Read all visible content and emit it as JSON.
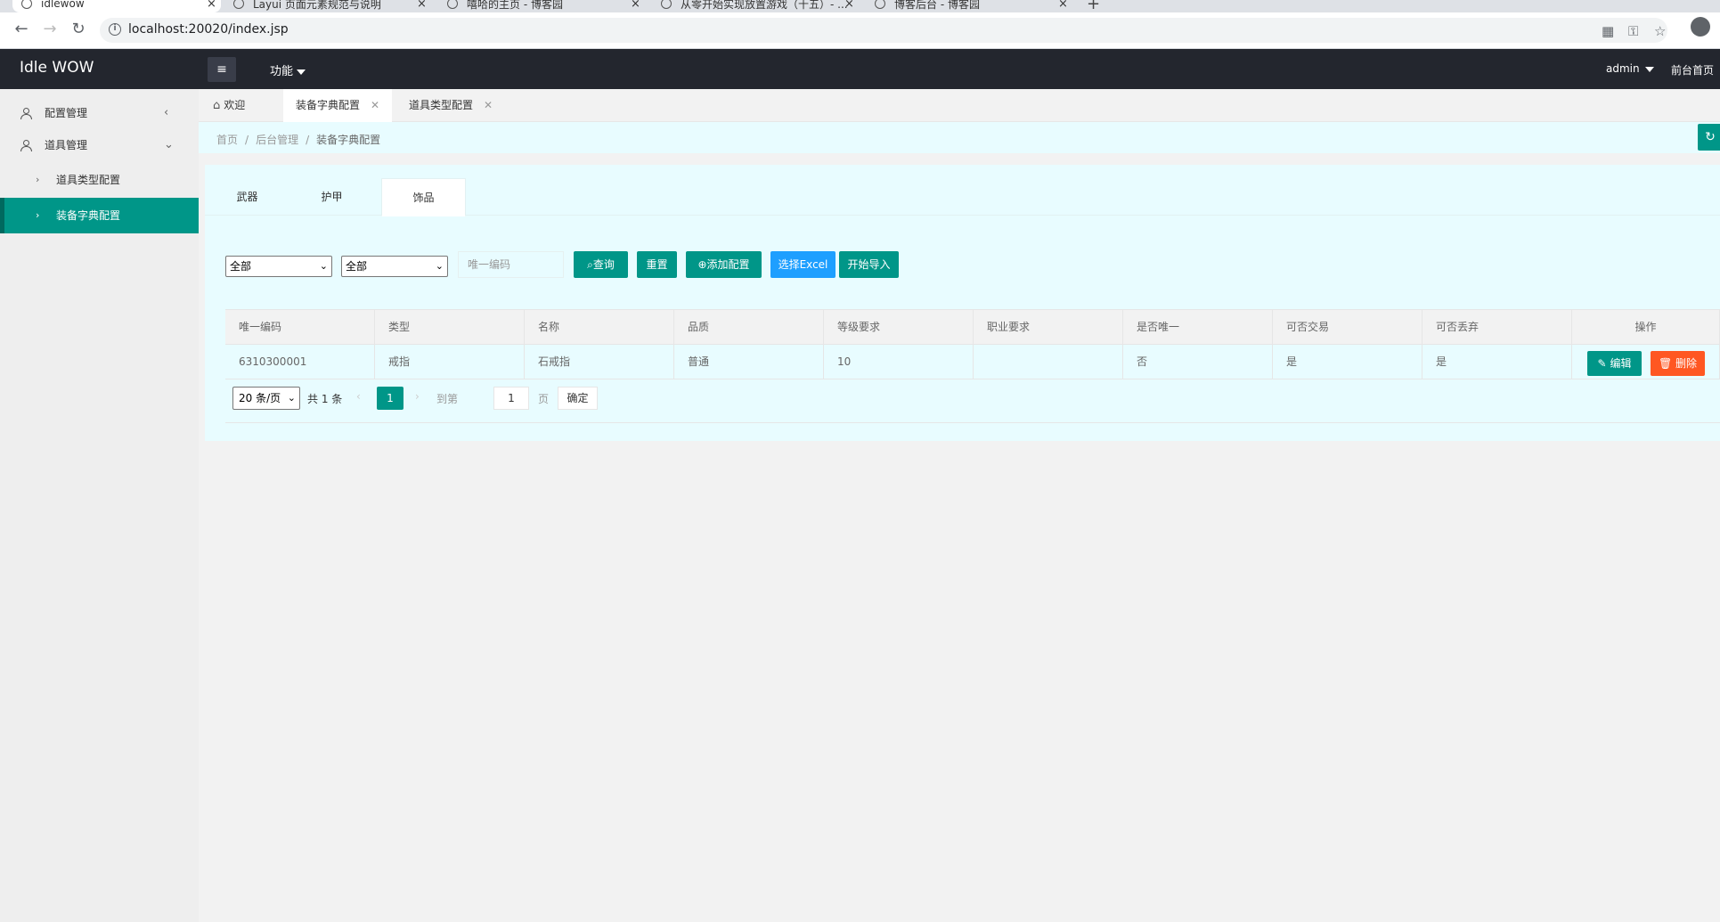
{
  "browser": {
    "tabs": [
      {
        "title": "idlewow",
        "close": "×"
      },
      {
        "title": "Layui 页面元素规范与说明",
        "close": "×"
      },
      {
        "title": "嘻哈的主页 - 博客园",
        "close": "×"
      },
      {
        "title": "从零开始实现放置游戏（十五）- ...",
        "close": "×"
      },
      {
        "title": "博客后台 - 博客园",
        "close": "×"
      }
    ],
    "new_tab": "+",
    "url": "localhost:20020/index.jsp"
  },
  "header": {
    "logo": "Idle WOW",
    "menu_icon": "≡",
    "func_label": "功能",
    "admin_label": "admin",
    "front_label": "前台首页"
  },
  "sidebar": {
    "items": [
      {
        "label": "配置管理",
        "chevron": "‹"
      },
      {
        "label": "道具管理",
        "chevron": "⌄"
      }
    ],
    "subitems": [
      {
        "label": "道具类型配置",
        "chevron": "›"
      },
      {
        "label": "装备字典配置",
        "chevron": "›"
      }
    ]
  },
  "page_tabs": [
    {
      "label": "欢迎",
      "icon": "⌂"
    },
    {
      "label": "装备字典配置",
      "close": "✕"
    },
    {
      "label": "道具类型配置",
      "close": "✕"
    }
  ],
  "breadcrumb": {
    "items": [
      "首页",
      "后台管理",
      "装备字典配置"
    ],
    "sep": "/",
    "refresh_icon": "↻"
  },
  "card_tabs": [
    "武器",
    "护甲",
    "饰品"
  ],
  "filters": {
    "select1": "全部",
    "select2": "全部",
    "dropdown_glyph": "⌄",
    "code_placeholder": "唯一编码",
    "search_btn": "查询",
    "search_icon": "⌕",
    "reset_btn": "重置",
    "add_btn": "添加配置",
    "add_icon": "⊕",
    "excel_btn": "选择Excel",
    "import_btn": "开始导入"
  },
  "table": {
    "headers": [
      "唯一编码",
      "类型",
      "名称",
      "品质",
      "等级要求",
      "职业要求",
      "是否唯一",
      "可否交易",
      "可否丢弃",
      "操作"
    ],
    "rows": [
      [
        "6310300001",
        "戒指",
        "石戒指",
        "普通",
        "10",
        "",
        "否",
        "是",
        "是"
      ]
    ],
    "edit_btn": "编辑",
    "edit_icon": "✎",
    "delete_btn": "删除",
    "delete_icon": "🗑"
  },
  "pager": {
    "page_size": "20 条/页",
    "total": "共 1 条",
    "prev": "‹",
    "next": "›",
    "current": "1",
    "goto_label": "到第",
    "goto_value": "1",
    "page_suffix": "页",
    "confirm": "确定"
  },
  "colors": {
    "primary": "#009688",
    "blue": "#1e9fff",
    "danger": "#ff5722",
    "header_bg": "#23262e"
  }
}
